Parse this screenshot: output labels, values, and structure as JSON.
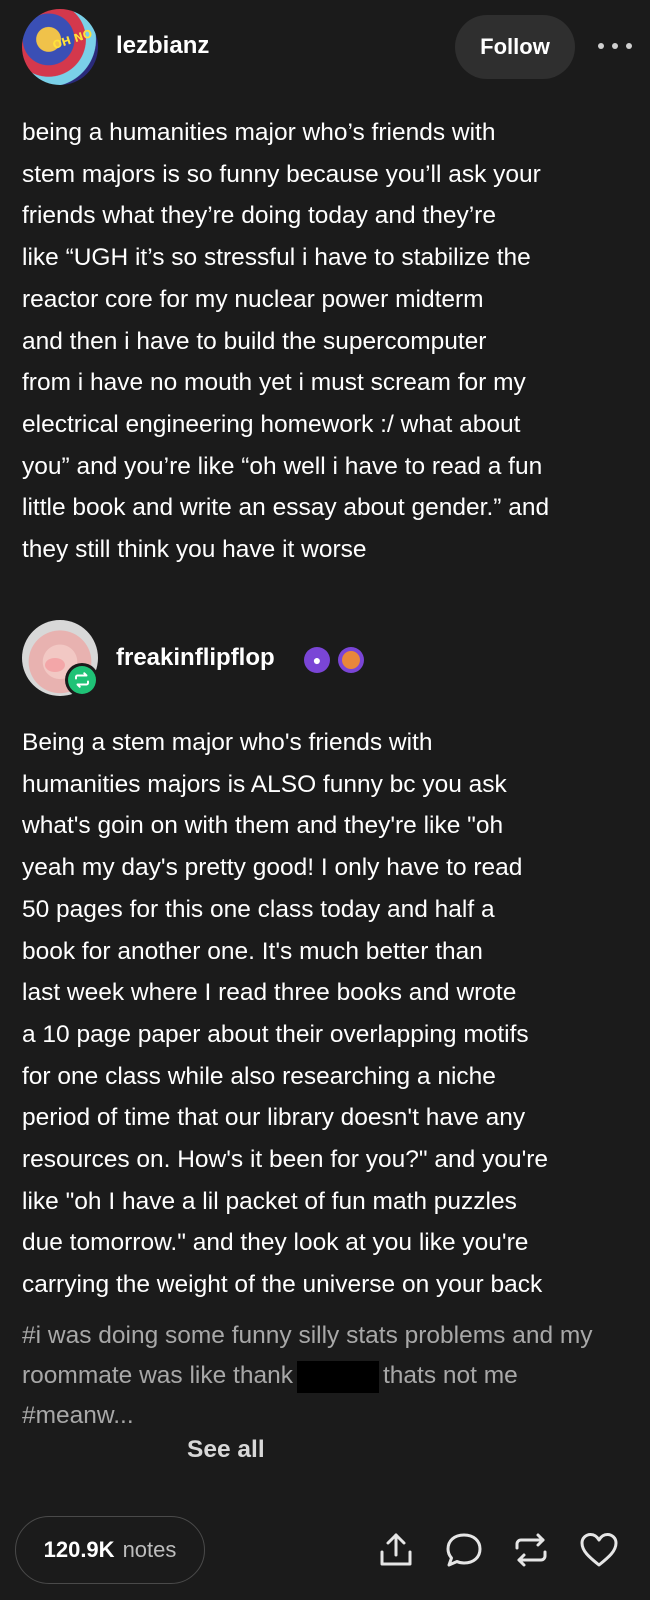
{
  "post": {
    "author": "lezbianz",
    "avatar_bubble_text": "OH NO",
    "follow_label": "Follow",
    "body": "being a humanities major who’s friends with\nstem majors is so funny because you’ll ask your\nfriends what they’re doing today and they’re\nlike “UGH it’s so stressful i have to stabilize the\nreactor core for my nuclear power midterm\nand then i have to build the supercomputer\nfrom i have no mouth yet i must scream for my\nelectrical engineering homework :/ what about\nyou” and you’re like “oh well i have to read a fun\nlittle book and write an essay about gender.” and\nthey still think you have it worse"
  },
  "reblog": {
    "author": "freakinflipflop",
    "body": "Being a stem major who's friends with\nhumanities majors is ALSO funny bc you ask\nwhat's goin on with them and they're like \"oh\nyeah my day's pretty good! I only have to read\n50 pages for this one class today and half a\nbook for another one. It's much better than\nlast week where I read three books and wrote\na 10 page paper about their overlapping motifs\nfor one class while also researching a niche\nperiod of time that our library doesn't have any\nresources on. How's it been for you?\" and you're\nlike \"oh I have a lil packet of fun math puzzles\ndue tomorrow.\" and they look at you like you're\ncarrying the weight of the universe on your back"
  },
  "tags": {
    "tag1_before": "#i was doing some funny silly stats problems and my roommate was like thank",
    "tag1_after": "thats not me",
    "tag2": "#meanw...",
    "see_all": "See all"
  },
  "footer": {
    "notes_count": "120.9K",
    "notes_label": "notes",
    "icons": [
      "share-icon",
      "reply-icon",
      "reblog-icon",
      "like-icon"
    ]
  },
  "colors": {
    "background": "#1b1b1b",
    "reblog_green": "#1fc276",
    "badge_purple": "#7a45d6",
    "tag_gray": "#a8a8a8"
  }
}
